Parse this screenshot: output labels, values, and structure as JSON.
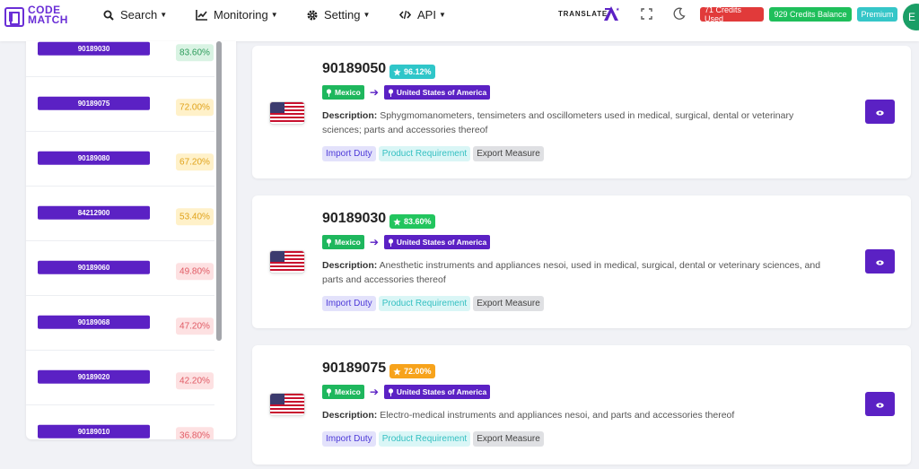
{
  "header": {
    "logo_line1": "CODE",
    "logo_line2": "MATCH",
    "nav": [
      {
        "label": "Search",
        "icon": "search-icon"
      },
      {
        "label": "Monitoring",
        "icon": "chart-icon"
      },
      {
        "label": "Setting",
        "icon": "gear-icon"
      },
      {
        "label": "API",
        "icon": "code-icon"
      }
    ],
    "translate_label": "TRANSLATE",
    "credits_used": "71 Credits Used",
    "credits_balance": "929 Credits Balance",
    "plan": "Premium",
    "avatar_initial": "E",
    "colors": {
      "brand": "#5b21c4",
      "used": "#e13a3a",
      "balance": "#1fbf5b",
      "plan": "#35c6c8"
    }
  },
  "sidebar": {
    "items": [
      {
        "code": "90189030",
        "pct": "83.60%",
        "level": "g"
      },
      {
        "code": "90189075",
        "pct": "72.00%",
        "level": "y"
      },
      {
        "code": "90189080",
        "pct": "67.20%",
        "level": "y"
      },
      {
        "code": "84212900",
        "pct": "53.40%",
        "level": "y"
      },
      {
        "code": "90189060",
        "pct": "49.80%",
        "level": "r"
      },
      {
        "code": "90189068",
        "pct": "47.20%",
        "level": "r"
      },
      {
        "code": "90189020",
        "pct": "42.20%",
        "level": "r"
      },
      {
        "code": "90189010",
        "pct": "36.80%",
        "level": "r"
      }
    ]
  },
  "results": [
    {
      "code": "90189050",
      "score": "96.12%",
      "from": "Mexico",
      "to": "United States of America",
      "desc_label": "Description:",
      "description": "Sphygmomanometers, tensimeters and oscillometers used in medical, surgical, dental or veterinary sciences; parts and accessories thereof"
    },
    {
      "code": "90189030",
      "score": "83.60%",
      "from": "Mexico",
      "to": "United States of America",
      "desc_label": "Description:",
      "description": "Anesthetic instruments and appliances nesoi, used in medical, surgical, dental or veterinary sciences, and parts and accessories thereof"
    },
    {
      "code": "90189075",
      "score": "72.00%",
      "from": "Mexico",
      "to": "United States of America",
      "desc_label": "Description:",
      "description": "Electro-medical instruments and appliances nesoi, and parts and accessories thereof"
    }
  ],
  "tags": {
    "import": "Import Duty",
    "product": "Product Requirement",
    "export": "Export Measure"
  }
}
